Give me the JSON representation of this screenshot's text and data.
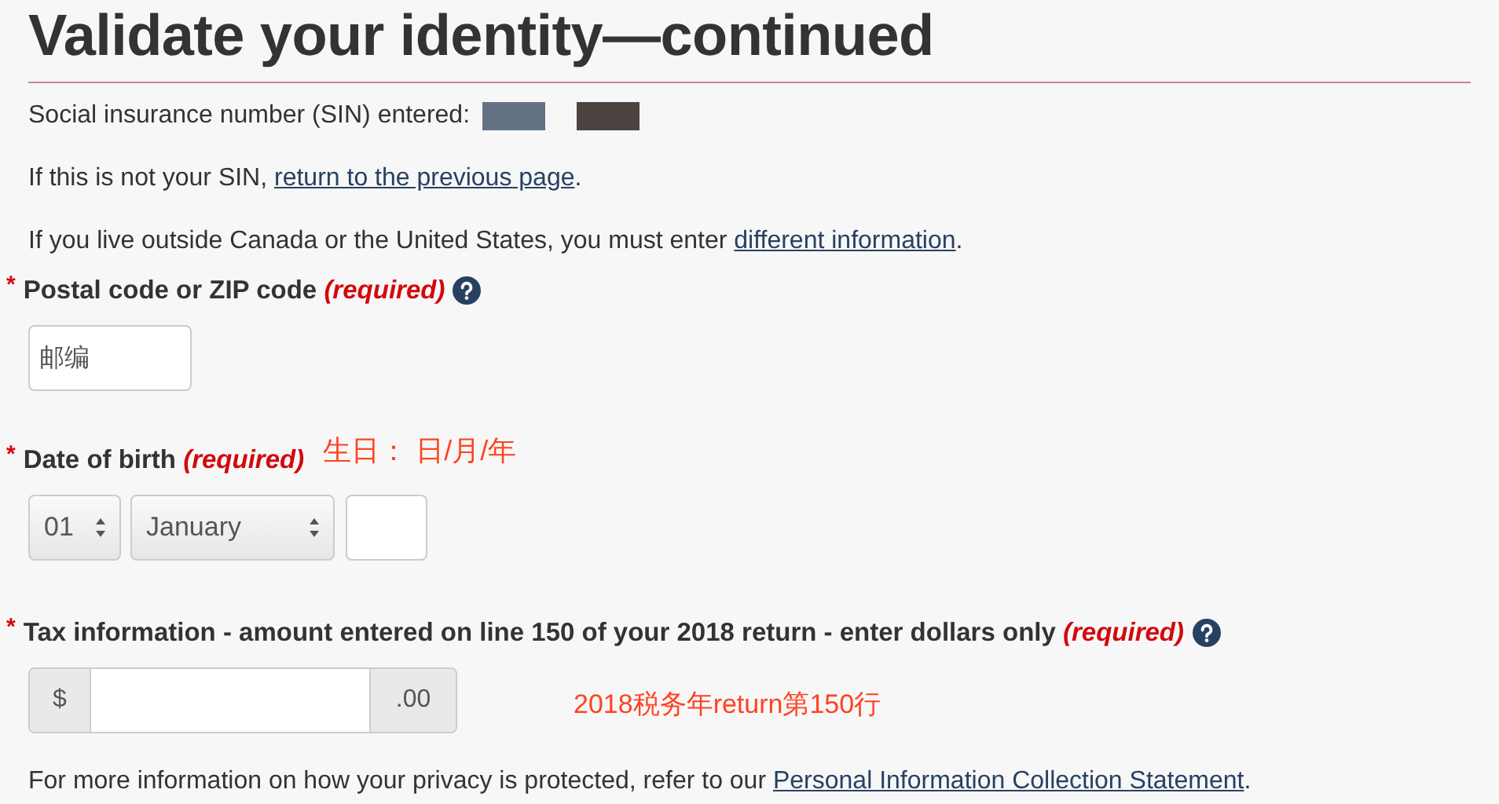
{
  "heading": "Validate your identity—continued",
  "sin": {
    "label": "Social insurance number (SIN) entered:",
    "redactions": [
      {
        "color": "#647384"
      },
      {
        "color": "#4a4340"
      }
    ]
  },
  "paragraphs": [
    {
      "before": "If this is not your SIN, ",
      "link": "return to the previous page",
      "after": "."
    },
    {
      "before": "If you live outside Canada or the United States, you must enter ",
      "link": "different information",
      "after": "."
    }
  ],
  "postal": {
    "marker": "*",
    "label": "Postal code or ZIP code",
    "required": "(required)",
    "help": true,
    "value": "邮编"
  },
  "birth": {
    "marker": "*",
    "label": "Date of birth",
    "required": "(required)",
    "note": "生日： 日/月/年",
    "day": "01",
    "month": "January"
  },
  "tax": {
    "marker": "*",
    "label": "Tax information - amount entered on line 150 of your 2018 return - enter dollars only",
    "required": "(required)",
    "help": true,
    "prefix": "$",
    "suffix": ".00",
    "note": "2018税务年return第150行"
  },
  "privacy": {
    "before": "For more information on how your privacy is protected, refer to our ",
    "link": "Personal Information Collection Statement",
    "after": "."
  }
}
